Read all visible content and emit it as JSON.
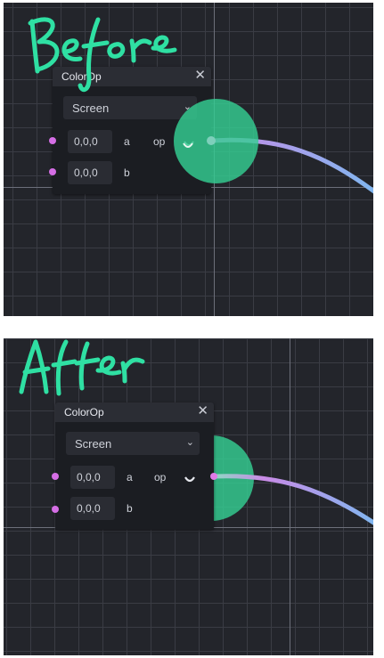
{
  "panels": [
    {
      "caption": "Before",
      "node": {
        "title": "ColorOp",
        "close": "✕",
        "select_value": "Screen",
        "inputs": [
          {
            "value": "0,0,0",
            "label": "a"
          },
          {
            "value": "0,0,0",
            "label": "b"
          }
        ],
        "output_label": "op"
      }
    },
    {
      "caption": "After",
      "node": {
        "title": "ColorOp",
        "close": "✕",
        "select_value": "Screen",
        "inputs": [
          {
            "value": "0,0,0",
            "label": "a"
          },
          {
            "value": "0,0,0",
            "label": "b"
          }
        ],
        "output_label": "op"
      }
    }
  ],
  "colors": {
    "handwriting": "#2fe0a3",
    "highlight": "#34ce92",
    "port": "#d56ee5",
    "wire_start": "#c98ae6",
    "wire_end": "#7fb8f0",
    "canvas": "#23252b",
    "node_body": "#1b1d22"
  }
}
